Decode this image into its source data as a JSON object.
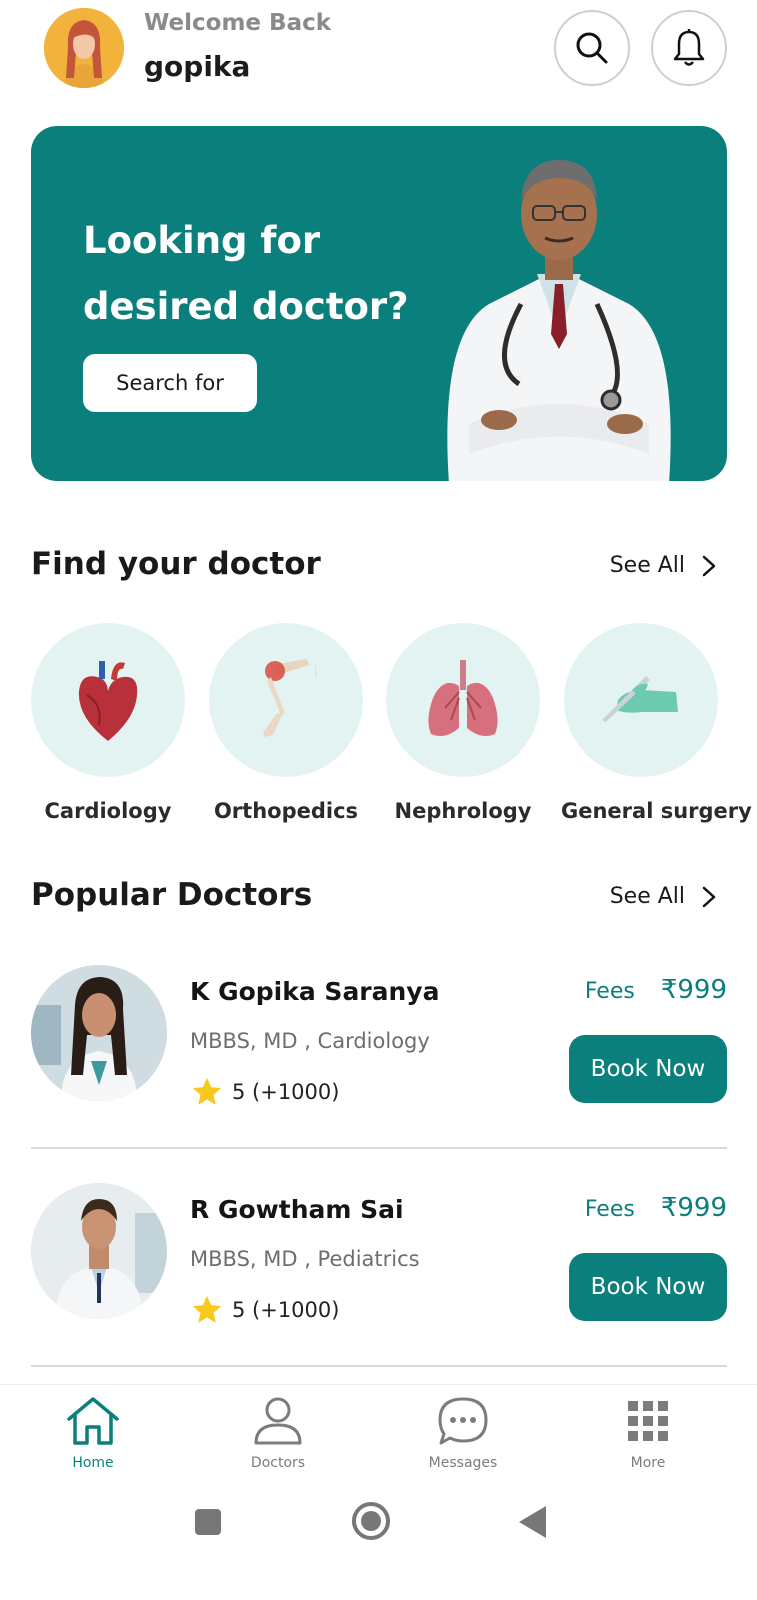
{
  "header": {
    "welcome": "Welcome Back",
    "username": "gopika",
    "search_icon": "search-icon",
    "bell_icon": "bell-icon"
  },
  "hero": {
    "title": "Looking for desired doctor?",
    "button_label": "Search for"
  },
  "find_section": {
    "title": "Find your doctor",
    "see_all": "See All",
    "specialities": [
      {
        "label": "Cardiology",
        "icon": "heart-icon"
      },
      {
        "label": "Orthopedics",
        "icon": "leg-bone-icon"
      },
      {
        "label": "Nephrology",
        "icon": "lungs-icon"
      },
      {
        "label": "General surgery",
        "icon": "scalpel-glove-icon"
      }
    ]
  },
  "popular_section": {
    "title": "Popular Doctors",
    "see_all": "See All",
    "doctors": [
      {
        "name": "K Gopika Saranya",
        "qualification": "MBBS, MD  , Cardiology",
        "rating": "5 (+1000)",
        "fees_label": "Fees",
        "fees": "₹999",
        "button": "Book Now"
      },
      {
        "name": "R Gowtham Sai",
        "qualification": "MBBS, MD  , Pediatrics",
        "rating": "5 (+1000)",
        "fees_label": "Fees",
        "fees": "₹999",
        "button": "Book Now"
      }
    ]
  },
  "bottom_nav": {
    "items": [
      {
        "label": "Home",
        "icon": "home-icon",
        "active": true
      },
      {
        "label": "Doctors",
        "icon": "person-icon",
        "active": false
      },
      {
        "label": "Messages",
        "icon": "chat-icon",
        "active": false
      },
      {
        "label": "More",
        "icon": "grid-icon",
        "active": false
      }
    ]
  },
  "colors": {
    "primary": "#0b7f7c",
    "spec_bg": "#e3f3f2",
    "avatar_bg": "#f2b33d"
  }
}
